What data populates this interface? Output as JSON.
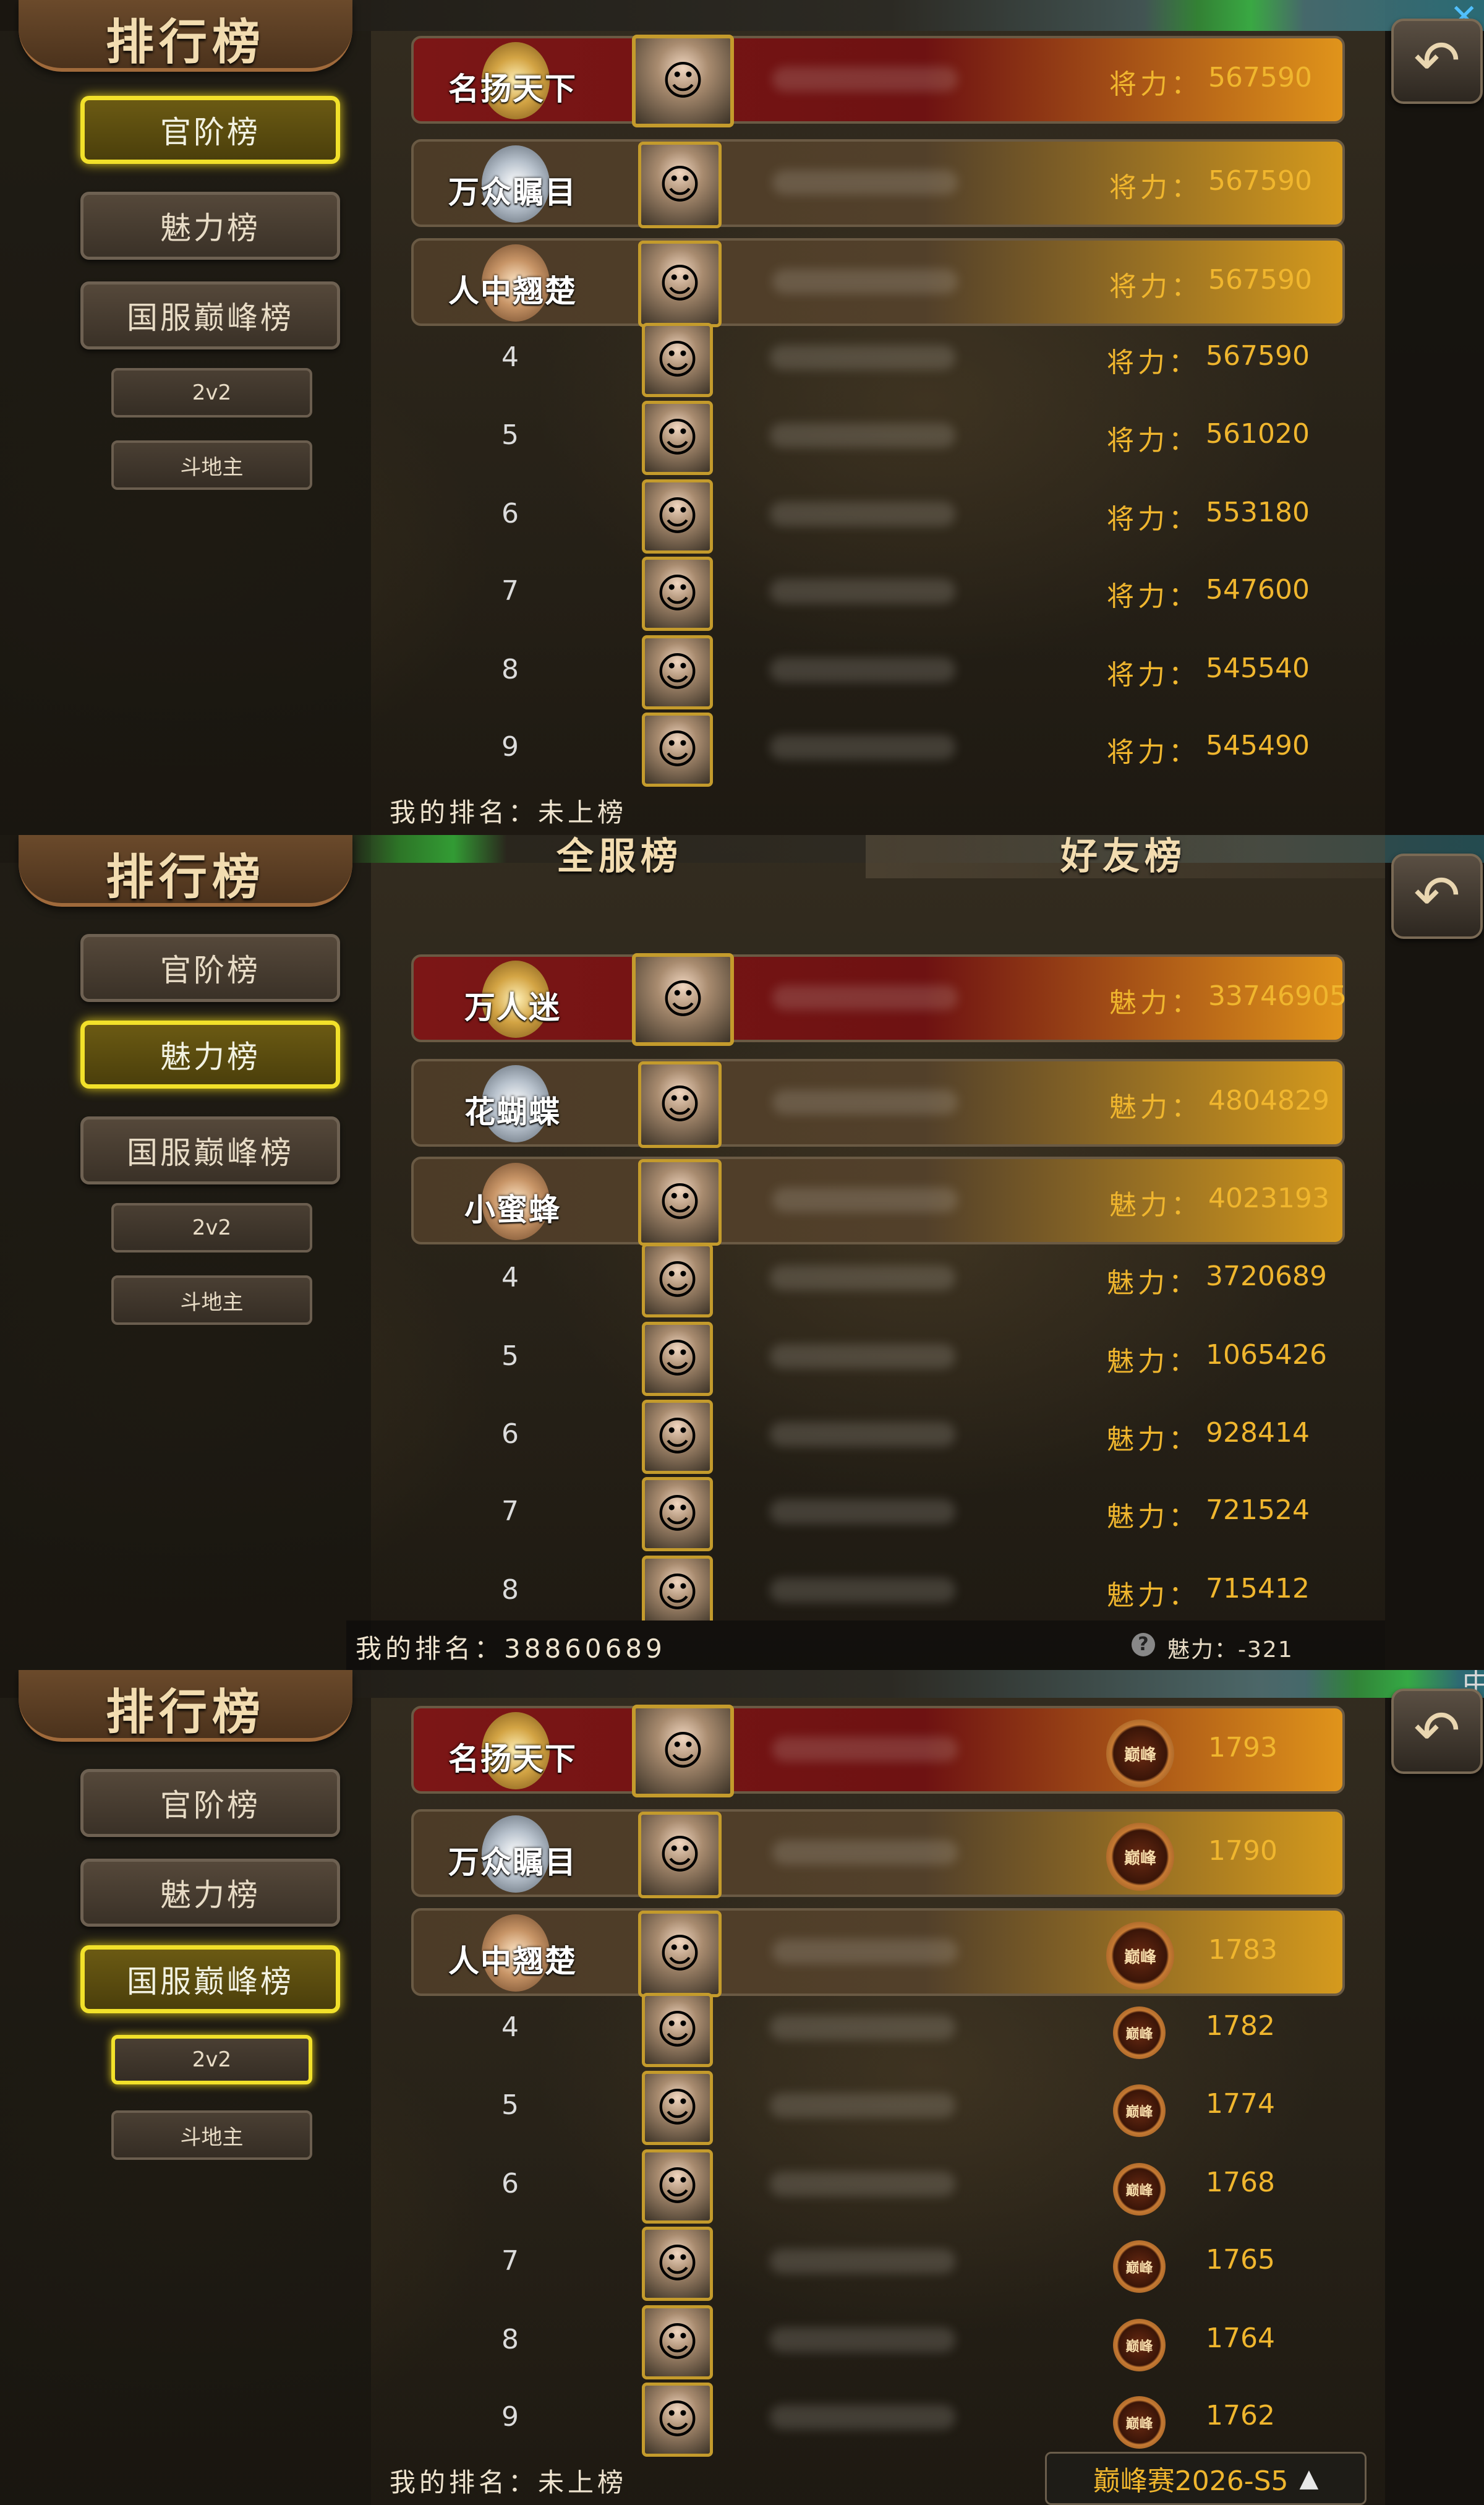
{
  "ui": {
    "title": "排行榜",
    "back_icon": "↶",
    "close_icon": "✕",
    "lang_mark": "中",
    "stat_label_power": "将力：",
    "stat_label_charm": "魅力：",
    "peak_icon_text": "巅峰",
    "nav": [
      "官阶榜",
      "魅力榜",
      "国服巅峰榜"
    ],
    "sub_nav": [
      "2v2",
      "斗地主"
    ]
  },
  "panel1": {
    "active_nav": "官阶榜",
    "badges": [
      "名扬天下",
      "万众瞩目",
      "人中翘楚"
    ],
    "rows": [
      {
        "rank": "1",
        "value": "567590"
      },
      {
        "rank": "2",
        "value": "567590"
      },
      {
        "rank": "3",
        "value": "567590"
      },
      {
        "rank": "4",
        "value": "567590"
      },
      {
        "rank": "5",
        "value": "561020"
      },
      {
        "rank": "6",
        "value": "553180"
      },
      {
        "rank": "7",
        "value": "547600"
      },
      {
        "rank": "8",
        "value": "545540"
      },
      {
        "rank": "9",
        "value": "545490"
      }
    ],
    "my_rank_label": "我的排名：",
    "my_rank_value": "未上榜"
  },
  "panel2": {
    "active_nav": "魅力榜",
    "tabs": [
      "全服榜",
      "好友榜"
    ],
    "badges": [
      "万人迷",
      "花蝴蝶",
      "小蜜蜂"
    ],
    "rows": [
      {
        "rank": "1",
        "value": "33746905"
      },
      {
        "rank": "2",
        "value": "4804829"
      },
      {
        "rank": "3",
        "value": "4023193"
      },
      {
        "rank": "4",
        "value": "3720689"
      },
      {
        "rank": "5",
        "value": "1065426"
      },
      {
        "rank": "6",
        "value": "928414"
      },
      {
        "rank": "7",
        "value": "721524"
      },
      {
        "rank": "8",
        "value": "715412"
      }
    ],
    "my_rank_label": "我的排名：",
    "my_rank_value": "38860689",
    "my_charm_label": "魅力：",
    "my_charm_value": "-321"
  },
  "panel3": {
    "active_nav": "国服巅峰榜",
    "active_sub": "2v2",
    "badges": [
      "名扬天下",
      "万众瞩目",
      "人中翘楚"
    ],
    "rows": [
      {
        "rank": "1",
        "value": "1793"
      },
      {
        "rank": "2",
        "value": "1790"
      },
      {
        "rank": "3",
        "value": "1783"
      },
      {
        "rank": "4",
        "value": "1782"
      },
      {
        "rank": "5",
        "value": "1774"
      },
      {
        "rank": "6",
        "value": "1768"
      },
      {
        "rank": "7",
        "value": "1765"
      },
      {
        "rank": "8",
        "value": "1764"
      },
      {
        "rank": "9",
        "value": "1762"
      }
    ],
    "my_rank_label": "我的排名：",
    "my_rank_value": "未上榜",
    "season_label": "巅峰赛2026-S5",
    "season_arrow": "▲"
  }
}
